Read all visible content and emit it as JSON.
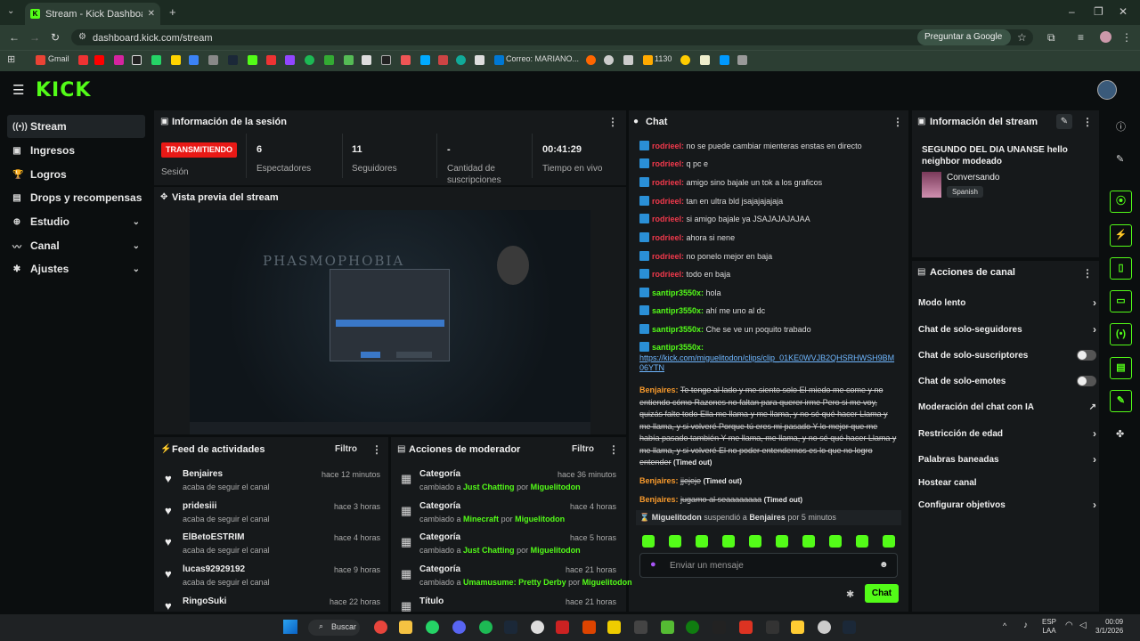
{
  "browser": {
    "tab_title": "Stream - Kick Dashboard",
    "url": "dashboard.kick.com/stream",
    "ask_google": "Preguntar a Google",
    "bookmarks": [
      "Gmail",
      "Correo: MARIANO...",
      "1130"
    ]
  },
  "sidebar": {
    "items": [
      {
        "label": "Stream",
        "icon": "broadcast-icon"
      },
      {
        "label": "Ingresos",
        "icon": "money-icon"
      },
      {
        "label": "Logros",
        "icon": "trophy-icon"
      },
      {
        "label": "Drops y recompensas",
        "icon": "gift-icon"
      },
      {
        "label": "Estudio",
        "icon": "studio-icon"
      },
      {
        "label": "Canal",
        "icon": "channel-icon"
      },
      {
        "label": "Ajustes",
        "icon": "gear-icon"
      }
    ]
  },
  "session": {
    "title": "Información de la sesión",
    "live_badge": "TRANSMITIENDO",
    "status_label": "Sesión",
    "viewers": "6",
    "viewers_label": "Espectadores",
    "followers": "11",
    "followers_label": "Seguidores",
    "subs": "-",
    "subs_label": "Cantidad de suscripciones",
    "live_time": "00:41:29",
    "live_time_label": "Tiempo en vivo"
  },
  "preview": {
    "title": "Vista previa del stream",
    "game_logo": "PHASMOPHOBIA"
  },
  "activity": {
    "title": "Feed de actividades",
    "filter": "Filtro",
    "items": [
      {
        "name": "Benjaires",
        "sub": "acaba de seguir el canal",
        "time": "hace 12 minutos"
      },
      {
        "name": "pridesiii",
        "sub": "acaba de seguir el canal",
        "time": "hace 3 horas"
      },
      {
        "name": "ElBetoESTRIM",
        "sub": "acaba de seguir el canal",
        "time": "hace 4 horas"
      },
      {
        "name": "lucas92929192",
        "sub": "acaba de seguir el canal",
        "time": "hace 9 horas"
      },
      {
        "name": "RingoSuki",
        "sub": "",
        "time": "hace 22 horas"
      }
    ]
  },
  "modactions": {
    "title": "Acciones de moderador",
    "filter": "Filtro",
    "items": [
      {
        "name": "Categoría",
        "pre": "cambiado a",
        "cat": "Just Chatting",
        "by": "por",
        "user": "Miguelitodon",
        "time": "hace 36 minutos"
      },
      {
        "name": "Categoría",
        "pre": "cambiado a",
        "cat": "Minecraft",
        "by": "por",
        "user": "Miguelitodon",
        "time": "hace 4 horas"
      },
      {
        "name": "Categoría",
        "pre": "cambiado a",
        "cat": "Just Chatting",
        "by": "por",
        "user": "Miguelitodon",
        "time": "hace 5 horas"
      },
      {
        "name": "Categoría",
        "pre": "cambiado a",
        "cat": "Umamusume: Pretty Derby",
        "by": "por",
        "user": "Miguelitodon",
        "time": "hace 21 horas"
      },
      {
        "name": "Título",
        "pre": "",
        "cat": "",
        "by": "",
        "user": "",
        "time": "hace 21 horas"
      }
    ]
  },
  "chat": {
    "title": "Chat",
    "messages": [
      {
        "user": "rodrieel:",
        "text": "no se puede cambiar mienteras enstas en directo"
      },
      {
        "user": "rodrieel:",
        "text": "q pc e"
      },
      {
        "user": "rodrieel:",
        "text": "amigo sino bajale un tok a los graficos"
      },
      {
        "user": "rodrieel:",
        "text": "tan en ultra bld jsajajajajaja"
      },
      {
        "user": "rodrieel:",
        "text": "si amigo bajale ya JSAJAJAJAJAA"
      },
      {
        "user": "rodrieel:",
        "text": "ahora si nene"
      },
      {
        "user": "rodrieel:",
        "text": "no ponelo mejor en baja"
      },
      {
        "user": "rodrieel:",
        "text": "todo en baja"
      },
      {
        "user": "santipr3550x:",
        "text": "hola"
      },
      {
        "user": "santipr3550x:",
        "text": "ahí me uno al dc"
      },
      {
        "user": "santipr3550x:",
        "text": "Che se ve un poquito trabado"
      },
      {
        "user": "santipr3550x:",
        "text": ""
      }
    ],
    "link": "https://kick.com/miguelitodon/clips/clip_01KE0WVJB2QHSRHWSH9BM06YTN",
    "long_user": "Benjaires:",
    "long_text": "Te tengo al lado y me siento solo El miedo me come y no entiendo cómo Razones no faltan para querer irme Pero si me voy, quizás falte todo Ella me llama y me llama, y no sé qué hacer Llama y me llama, y si volveré Porque tú eres mi pasado Y lo mejor que me había pasado también Y me llama, me llama, y no sé qué hacer Llama y me llama, y si volveré El no poder entendernos es lo que no logro entender",
    "timed_out": "(Timed out)",
    "m2_user": "Benjaires:",
    "m2_text": "jjejeje",
    "m3_user": "Benjaires:",
    "m3_text": "jugamo al seaaaaaaaa",
    "mod_note": {
      "mod": "Miguelitodon",
      "action": "suspendió a",
      "target": "Benjaires",
      "duration": "por 5 minutos"
    },
    "input_placeholder": "Enviar un mensaje",
    "send_label": "Chat"
  },
  "stream_info": {
    "title": "Información del stream",
    "stream_title": "SEGUNDO DEL DIA UNANSE hello neighbor modeado",
    "category": "Conversando",
    "language": "Spanish"
  },
  "channel_actions": {
    "title": "Acciones de canal",
    "items": [
      {
        "label": "Modo lento",
        "control": "chevron"
      },
      {
        "label": "Chat de solo-seguidores",
        "control": "chevron"
      },
      {
        "label": "Chat de solo-suscriptores",
        "control": "toggle"
      },
      {
        "label": "Chat de solo-emotes",
        "control": "toggle"
      },
      {
        "label": "Moderación del chat con IA",
        "control": "external"
      },
      {
        "label": "Restricción de edad",
        "control": "chevron"
      },
      {
        "label": "Palabras baneadas",
        "control": "chevron"
      },
      {
        "label": "Hostear canal",
        "control": "none"
      },
      {
        "label": "Configurar objetivos",
        "control": "chevron"
      }
    ]
  },
  "taskbar": {
    "search": "Buscar",
    "lang": "ESP",
    "lang2": "LAA",
    "time": "00:09",
    "date": "3/1/2026"
  },
  "colors": {
    "accent": "#53fc18",
    "live": "#e91916",
    "username_red": "#f2394c",
    "username_orange": "#f89a2c"
  }
}
